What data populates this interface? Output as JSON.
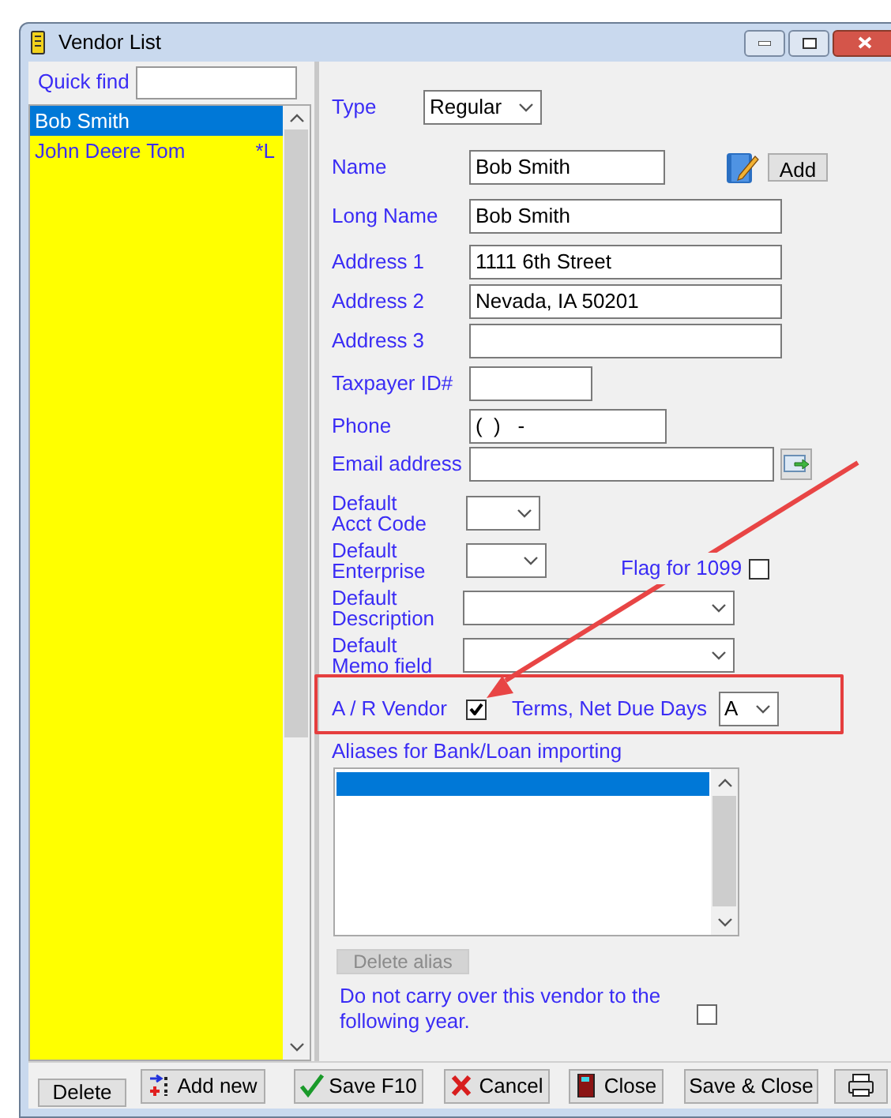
{
  "window": {
    "title": "Vendor List"
  },
  "quick_find": {
    "label": "Quick find"
  },
  "vendors": [
    {
      "name": "Bob Smith",
      "selected": true
    },
    {
      "name": "John Deere Tom",
      "flag": "*L",
      "selected": false
    }
  ],
  "form": {
    "type": {
      "label": "Type",
      "value": "Regular"
    },
    "name": {
      "label": "Name",
      "value": "Bob Smith"
    },
    "add_button": "Add",
    "long_name": {
      "label": "Long Name",
      "value": "Bob Smith"
    },
    "address_1": {
      "label": "Address 1",
      "value": "1111 6th Street"
    },
    "address_2": {
      "label": "Address 2",
      "value": "Nevada, IA 50201"
    },
    "address_3": {
      "label": "Address 3"
    },
    "taxpayer_id": {
      "label": "Taxpayer ID#"
    },
    "phone": {
      "label": "Phone",
      "value": "(  )   -"
    },
    "email": {
      "label": "Email address"
    },
    "default_acct_code": {
      "label_lines": [
        "Default",
        "Acct Code"
      ]
    },
    "default_enterprise": {
      "label_lines": [
        "Default",
        "Enterprise"
      ]
    },
    "flag_1099": {
      "label": "Flag for 1099",
      "checked": false
    },
    "default_description": {
      "label_lines": [
        "Default",
        "Description"
      ]
    },
    "default_memo": {
      "label_lines": [
        "Default",
        "Memo field"
      ]
    },
    "ar_vendor": {
      "label": "A / R Vendor",
      "checked": true
    },
    "terms": {
      "label": "Terms, Net Due Days",
      "value": "A"
    },
    "aliases": {
      "label": "Aliases for Bank/Loan importing",
      "items": [
        {
          "selected": true
        }
      ]
    },
    "delete_alias": {
      "label": "Delete alias",
      "disabled": true
    },
    "carry_over": {
      "label": "Do not carry over this vendor to the following year.",
      "checked": false
    }
  },
  "buttons": [
    {
      "kind": "plain",
      "label": "Delete"
    },
    {
      "kind": "add",
      "label": "Add new"
    },
    {
      "kind": "save",
      "label": "Save F10"
    },
    {
      "kind": "cancel",
      "label": "Cancel"
    },
    {
      "kind": "close",
      "label": "Close"
    },
    {
      "kind": "plain",
      "label": "Save & Close"
    },
    {
      "kind": "print"
    }
  ]
}
